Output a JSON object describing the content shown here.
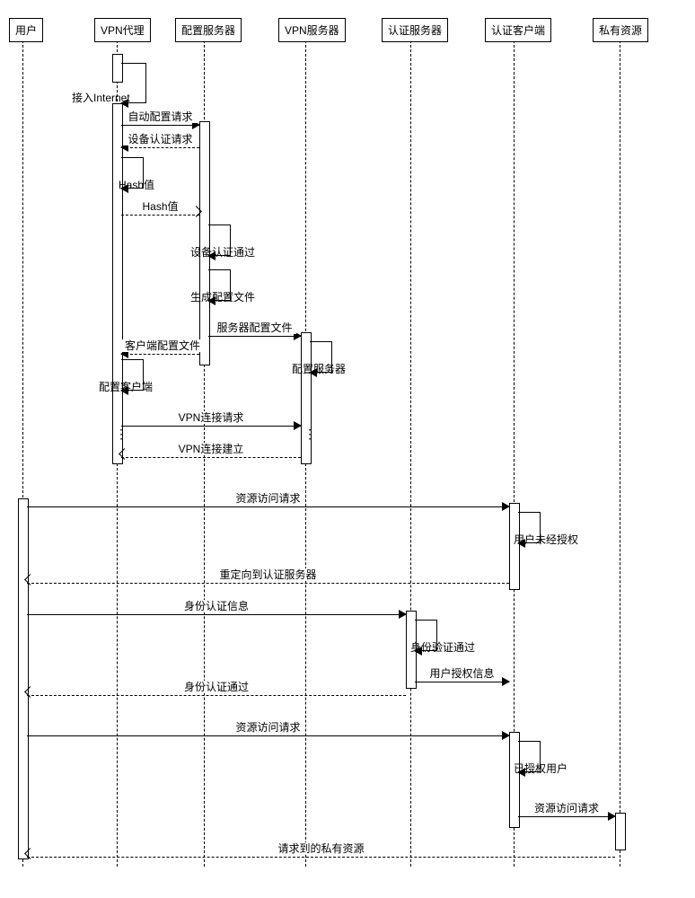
{
  "participants": {
    "user": "用户",
    "vpn_proxy": "VPN代理",
    "config_server": "配置服务器",
    "vpn_server": "VPN服务器",
    "auth_server": "认证服务器",
    "auth_client": "认证客户端",
    "private_res": "私有资源"
  },
  "messages": {
    "internet": "接入Internet",
    "auto_config_req": "自动配置请求",
    "device_auth_req": "设备认证请求",
    "hash_self": "Hash值",
    "hash_send": "Hash值",
    "device_auth_pass": "设备认证通过",
    "gen_config": "生成配置文件",
    "server_config_file": "服务器配置文件",
    "client_config_file": "客户端配置文件",
    "config_server_setup": "配置服务器",
    "config_client_setup": "配置客户端",
    "vpn_conn_req": "VPN连接请求",
    "vpn_conn_est": "VPN连接建立",
    "res_access_req1": "资源访问请求",
    "user_unauth": "用户未经授权",
    "redirect_auth": "重定向到认证服务器",
    "identity_info": "身份认证信息",
    "identity_pass": "身份验证通过",
    "user_auth_info": "用户授权信息",
    "identity_auth_pass": "身份认证通过",
    "res_access_req2": "资源访问请求",
    "authed_user": "已授权用户",
    "res_access_req3": "资源访问请求",
    "req_private_res": "请求到的私有资源"
  }
}
